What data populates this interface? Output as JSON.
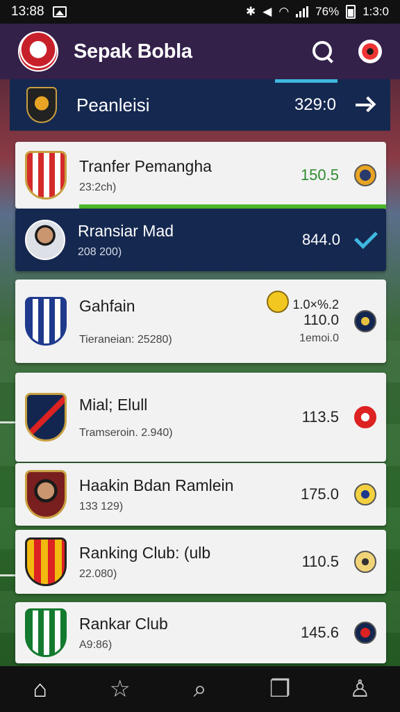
{
  "status_bar": {
    "time_left": "13:88",
    "battery_text": "76%",
    "time_right": "1:3:0"
  },
  "app_bar": {
    "title": "Sepak Bobla"
  },
  "header_row": {
    "title": "Peanleisi",
    "value": "329:0"
  },
  "items": [
    {
      "name": "Tranfer Pemangha",
      "sub": "23:2ch)",
      "value": "150.5"
    },
    {
      "name": "Rransiar Mad",
      "sub": "208 200)",
      "value": "844.0"
    },
    {
      "name": "Gahfain",
      "sub": "Tieraneian: 25280)",
      "value_lines": [
        "1.0×%.2",
        "110.0",
        "1emoi.0"
      ]
    },
    {
      "name": "Mial; Elull",
      "sub": "Tramseroin. 2.940)",
      "value": "113.5"
    },
    {
      "name": "Haakin Bdan Ramlein",
      "sub": "133 129)",
      "value": "175.0"
    },
    {
      "name": "Ranking Club: (ulb",
      "sub": "22.080)",
      "value": "110.5"
    },
    {
      "name": "Rankar Club",
      "sub": "A9:86)",
      "value": "145.6"
    }
  ],
  "bottom_nav": [
    "home-icon",
    "star-icon",
    "search-icon",
    "copy-icon",
    "profile-icon"
  ],
  "colors": {
    "app_bar": "#33214a",
    "header": "#152850",
    "accent_green": "#4ab82a",
    "accent_blue": "#3fb8e0"
  }
}
